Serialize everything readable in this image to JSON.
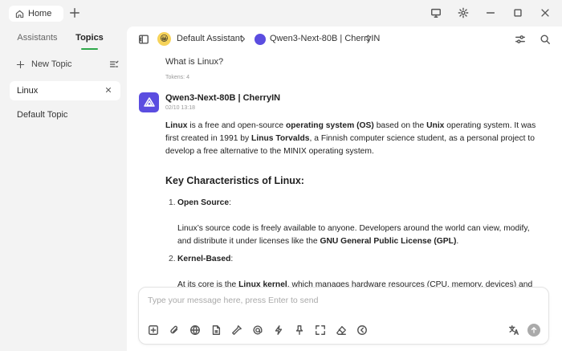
{
  "titlebar": {
    "home_tab": "Home"
  },
  "sidebar": {
    "tabs": [
      "Assistants",
      "Topics"
    ],
    "active_tab": "Topics",
    "new_topic": "New Topic",
    "topics": [
      "Linux",
      "Default Topic"
    ],
    "active_topic": "Linux"
  },
  "header": {
    "assistant_name": "Default Assistant",
    "model_name": "Qwen3-Next-80B | CherryIN"
  },
  "messages": {
    "user_text": "What is Linux?",
    "user_tokens": "Tokens: 4",
    "bot_name": "Qwen3-Next-80B | CherryIN",
    "bot_time": "02/10 13:18",
    "intro": {
      "p1": "Linux",
      "p2": " is a free and open-source ",
      "p3": "operating system (OS)",
      "p4": " based on the ",
      "p5": "Unix",
      "p6": " operating system. It was first created in 1991 by ",
      "p7": "Linus Torvalds",
      "p8": ", a Finnish computer science student, as a personal project to develop a free alternative to the MINIX operating system."
    },
    "heading": "Key Characteristics of Linux:",
    "item1": {
      "num": "1.",
      "title": "Open Source",
      "colon": ":",
      "desc_a": "Linux’s source code is freely available to anyone. Developers around the world can view, modify, and distribute it under licenses like the ",
      "desc_b": "GNU General Public License (GPL)",
      "desc_c": "."
    },
    "item2": {
      "num": "2.",
      "title": "Kernel-Based",
      "colon": ":",
      "desc_a": "At its core is the ",
      "desc_b": "Linux kernel",
      "desc_c": ", which manages hardware resources (CPU, memory, devices) and"
    }
  },
  "input": {
    "placeholder": "Type your message here, press Enter to send"
  },
  "colors": {
    "accent": "#2ea84a",
    "model_brand": "#5b4de0"
  }
}
